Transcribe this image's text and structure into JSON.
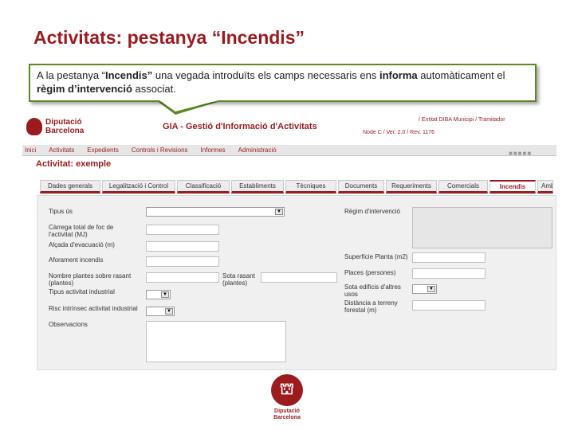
{
  "slide": {
    "title": "Activitats: pestanya “Incendis”",
    "callout": {
      "t1": "A la pestanya “",
      "b1": "Incendis”",
      "t2": " una vegada introduïts els camps necessaris ens ",
      "b2": "informa",
      "t3": " automàticament el ",
      "b3": "règim d’intervenció",
      "t4": " associat."
    }
  },
  "app": {
    "logo": {
      "line1": "Diputació",
      "line2": "Barcelona"
    },
    "title": "GIA - Gestió d'Informació d'Activitats",
    "meta1": "/ Entitat DIBA Municipi / Tramitador",
    "meta2": "Node C / Ver. 2.0 / Rev. 1176",
    "menu": [
      "Inici",
      "Activitats",
      "Expedients",
      "Controls i Revisions",
      "Informes",
      "Administració"
    ],
    "activity_title": "Activitat: exemple",
    "tabs": [
      "Dades generals",
      "Legalització i Control",
      "Classificació",
      "Establiments",
      "Tècniques",
      "Documents",
      "Requeriments",
      "Comercials",
      "Incendis",
      "Ambi"
    ],
    "form": {
      "tipus_us": "Tipus ús",
      "carrega_foc": "Càrrega total de foc de l'activitat (MJ)",
      "alcada": "Alçada d'evacuació (m)",
      "aforament": "Aforament incendis",
      "plantes_rasant": "Nombre plantes sobre rasant (plantes)",
      "sota_rasant": "Sota rasant (plantes)",
      "tipus_industrial": "Tipus activitat industrial",
      "risc": "Risc intrínsec activitat industrial",
      "observacions": "Observacions",
      "regim": "Règim d'intervenció",
      "superficie": "Superfície Planta (m2)",
      "places": "Places (persones)",
      "sota_edificis": "Sota edificis d'altres usos",
      "distancia": "Distància a terreny forestal (m)"
    }
  },
  "footer_logo": {
    "line1": "Diputació",
    "line2": "Barcelona"
  }
}
